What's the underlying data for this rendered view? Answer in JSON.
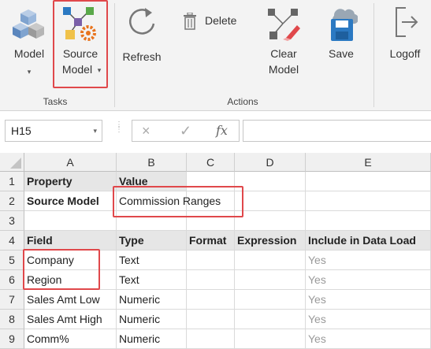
{
  "ribbon": {
    "model": {
      "label": "Model",
      "icon": "cubes-icon"
    },
    "source_model": {
      "label_1": "Source",
      "label_2": "Model",
      "icon": "source-model-icon"
    },
    "refresh": {
      "label": "Refresh",
      "icon": "refresh-icon"
    },
    "delete": {
      "label": "Delete",
      "icon": "trash-icon"
    },
    "clear_model": {
      "label_1": "Clear",
      "label_2": "Model",
      "icon": "clear-model-icon"
    },
    "save": {
      "label": "Save",
      "icon": "save-icon"
    },
    "logoff": {
      "label": "Logoff",
      "icon": "logoff-icon"
    },
    "groups": {
      "tasks": "Tasks",
      "actions": "Actions"
    },
    "colors": {
      "accent_red": "#e0484b",
      "save_blue": "#2b79c2",
      "gear_orange": "#e8741e"
    }
  },
  "formula_bar": {
    "name_box": "H15",
    "cancel_symbol": "×",
    "enter_symbol": "✓",
    "fx_symbol": "fx",
    "formula": ""
  },
  "sheet": {
    "columns": [
      "A",
      "B",
      "C",
      "D",
      "E"
    ],
    "rows": [
      {
        "num": "1",
        "cells": [
          "Property",
          "Value",
          "",
          "",
          ""
        ]
      },
      {
        "num": "2",
        "cells": [
          "Source Model",
          "Commission Ranges",
          "",
          "",
          ""
        ]
      },
      {
        "num": "3",
        "cells": [
          "",
          "",
          "",
          "",
          ""
        ]
      },
      {
        "num": "4",
        "cells": [
          "Field",
          "Type",
          "Format",
          "Expression",
          "Include in Data Load"
        ]
      },
      {
        "num": "5",
        "cells": [
          "Company",
          "Text",
          "",
          "",
          "Yes"
        ]
      },
      {
        "num": "6",
        "cells": [
          "Region",
          "Text",
          "",
          "",
          "Yes"
        ]
      },
      {
        "num": "7",
        "cells": [
          "Sales Amt Low",
          "Numeric",
          "",
          "",
          "Yes"
        ]
      },
      {
        "num": "8",
        "cells": [
          "Sales Amt High",
          "Numeric",
          "",
          "",
          "Yes"
        ]
      },
      {
        "num": "9",
        "cells": [
          "Comm%",
          "Numeric",
          "",
          "",
          "Yes"
        ]
      }
    ]
  }
}
